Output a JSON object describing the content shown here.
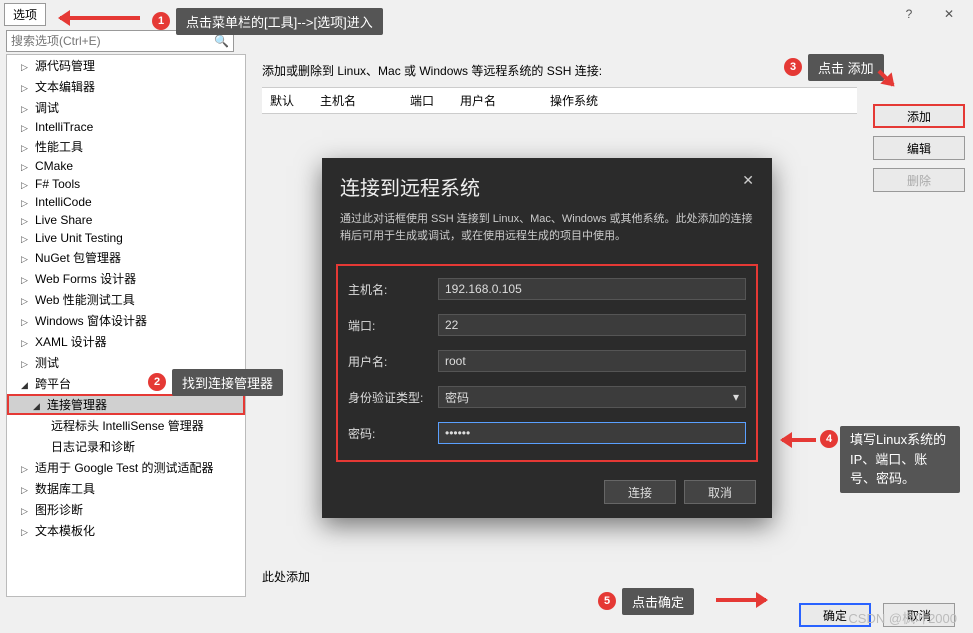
{
  "title_tab": "选项",
  "search_placeholder": "搜索选项(Ctrl+E)",
  "tree": {
    "items": [
      "源代码管理",
      "文本编辑器",
      "调试",
      "IntelliTrace",
      "性能工具",
      "CMake",
      "F# Tools",
      "IntelliCode",
      "Live Share",
      "Live Unit Testing",
      "NuGet 包管理器",
      "Web Forms 设计器",
      "Web 性能测试工具",
      "Windows 窗体设计器",
      "XAML 设计器",
      "测试"
    ],
    "open_label": "跨平台",
    "selected_label": "连接管理器",
    "child1": "远程标头 IntelliSense 管理器",
    "child2": "日志记录和诊断",
    "items_after": [
      "适用于 Google Test 的测试适配器",
      "数据库工具",
      "图形诊断",
      "文本模板化"
    ]
  },
  "main": {
    "desc": "添加或删除到 Linux、Mac 或 Windows 等远程系统的 SSH 连接:",
    "cols": {
      "c1": "默认",
      "c2": "主机名",
      "c3": "端口",
      "c4": "用户名",
      "c5": "操作系统"
    },
    "footnote": "此处添加"
  },
  "buttons": {
    "add": "添加",
    "edit": "编辑",
    "del": "删除",
    "ok": "确定",
    "cancel": "取消"
  },
  "modal": {
    "title": "连接到远程系统",
    "desc": "通过此对话框使用 SSH 连接到 Linux、Mac、Windows 或其他系统。此处添加的连接稍后可用于生成或调试，或在使用远程生成的项目中使用。",
    "labels": {
      "host": "主机名:",
      "port": "端口:",
      "user": "用户名:",
      "auth": "身份验证类型:",
      "pwd": "密码:"
    },
    "values": {
      "host": "192.168.0.105",
      "port": "22",
      "user": "root",
      "auth": "密码",
      "pwd": "••••••"
    },
    "connect": "连接",
    "cancel": "取消"
  },
  "anno": {
    "b1": "1",
    "t1": "点击菜单栏的[工具]-->[选项]进入",
    "b2": "2",
    "t2": "找到连接管理器",
    "b3": "3",
    "t3": "点击 添加",
    "b4": "4",
    "t4": "填写Linux系统的IP、端口、账号、密码。",
    "b5": "5",
    "t5": "点击确定"
  },
  "watermark": "CSDN @枫叶2000"
}
